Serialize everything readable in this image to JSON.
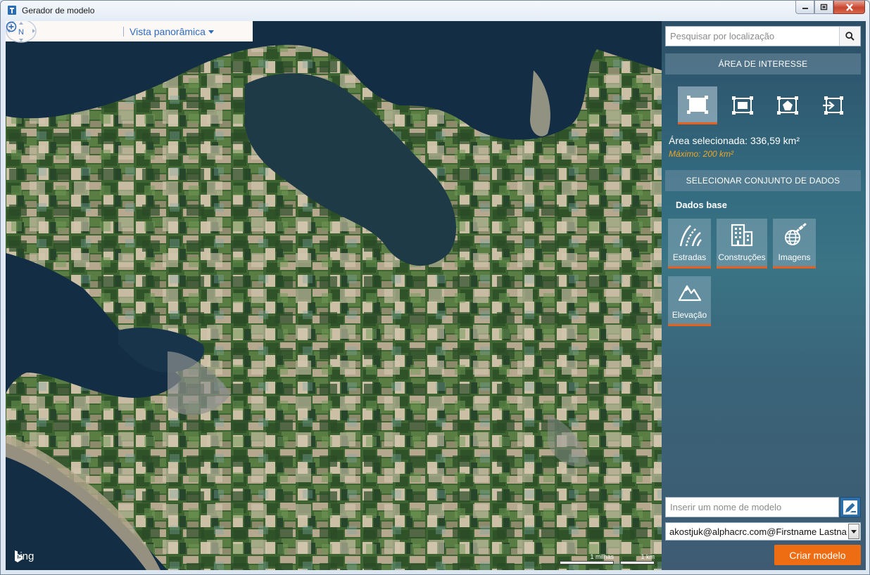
{
  "window": {
    "title": "Gerador de modelo"
  },
  "map": {
    "toolbar": {
      "compass_label": "N",
      "view_label": "Vista panorâmica"
    },
    "bing_label": "bing",
    "scale": {
      "miles": "1 milhas",
      "km": "1 km"
    }
  },
  "panel": {
    "search": {
      "placeholder": "Pesquisar por localização"
    },
    "area_header": "ÁREA DE INTERESSE",
    "tools": [
      {
        "icon": "rectangle-select-icon",
        "active": true
      },
      {
        "icon": "fit-rectangle-icon",
        "active": false
      },
      {
        "icon": "polygon-select-icon",
        "active": false
      },
      {
        "icon": "import-area-icon",
        "active": false
      }
    ],
    "selected_area": "Área selecionada: 336,59 km²",
    "max_area": "Máximo: 200 km²",
    "dataset_header": "SELECIONAR CONJUNTO DE DADOS",
    "base_data_label": "Dados base",
    "datasets": [
      {
        "label": "Estradas",
        "icon": "roads-icon"
      },
      {
        "label": "Construções",
        "icon": "buildings-icon"
      },
      {
        "label": "Imagens",
        "icon": "satellite-globe-icon"
      },
      {
        "label": "Elevação",
        "icon": "mountain-icon"
      }
    ],
    "model_name": {
      "placeholder": "Inserir um nome de modelo"
    },
    "account": "akostjuk@alphacrc.com@Firstname Lastname",
    "create_button": "Criar modelo"
  },
  "colors": {
    "accent": "#ef6d12",
    "panel_top": "#2c4e66",
    "panel_mid": "#3a7485",
    "max_text": "#f0a623",
    "link": "#2f6bc0"
  }
}
